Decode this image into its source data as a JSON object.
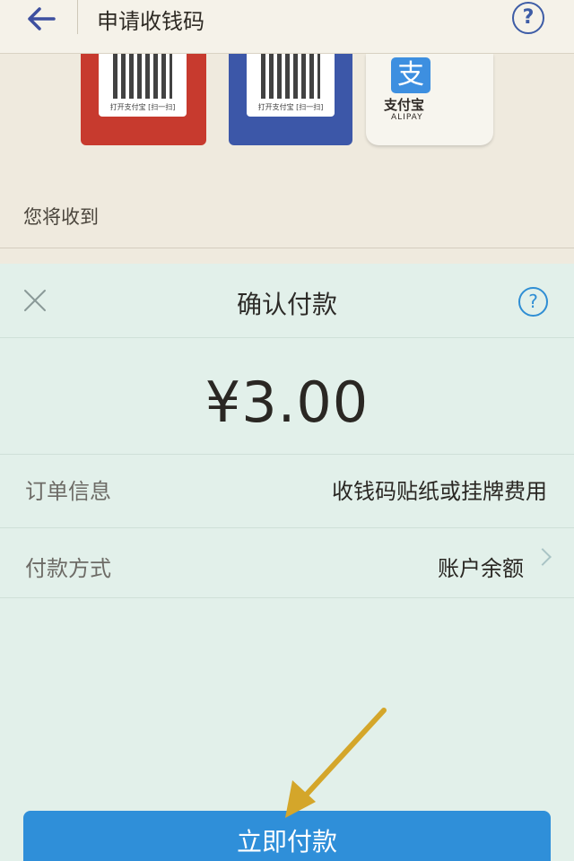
{
  "background": {
    "title": "申请收钱码",
    "receive_label": "您将收到",
    "promo": {
      "red_caption": "打开支付宝 [扫一扫]",
      "blue_caption": "打开支付宝 [扫一扫]",
      "brand_name": "支付宝",
      "brand_en": "ALIPAY",
      "brand_glyph": "支"
    }
  },
  "sheet": {
    "title": "确认付款",
    "amount": "¥3.00",
    "rows": [
      {
        "label": "订单信息",
        "value": "收钱码贴纸或挂牌费用"
      },
      {
        "label": "付款方式",
        "value": "账户余额"
      }
    ],
    "pay_button": "立即付款"
  },
  "colors": {
    "accent": "#2f8fd9",
    "sheet_bg": "#e2f0ea",
    "arrow": "#d4a62a"
  },
  "icons": {
    "back": "arrow-left-icon",
    "help": "question-circle-icon",
    "close": "close-icon",
    "chevron": "chevron-right-icon"
  }
}
